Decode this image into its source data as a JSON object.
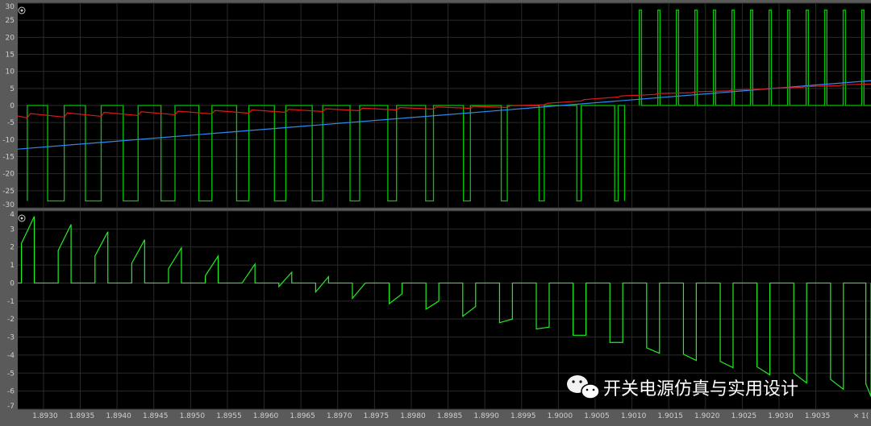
{
  "colors": {
    "background": "#000000",
    "frame": "#5a5a5a",
    "grid": "#2a2a2a",
    "tick_text": "#cfcfcf",
    "gate_green": "#00c800",
    "bright_green": "#22ee22",
    "red": "#e01818",
    "blue": "#2d8cf0"
  },
  "watermark": {
    "icon": "wechat-icon",
    "text": "开关电源仿真与实用设计"
  },
  "x_axis": {
    "range": [
      1.89265,
      1.90425
    ],
    "ticks": [
      "1.8930",
      "1.8935",
      "1.8940",
      "1.8945",
      "1.8950",
      "1.8955",
      "1.8960",
      "1.8965",
      "1.8970",
      "1.8975",
      "1.8980",
      "1.8985",
      "1.8990",
      "1.8995",
      "1.9000",
      "1.9005",
      "1.9010",
      "1.9015",
      "1.9020",
      "1.9025",
      "1.9030",
      "1.9035"
    ],
    "truncated_label": "1("
  },
  "chart_data": [
    {
      "type": "line",
      "title": "",
      "xlabel": "",
      "ylabel": "",
      "xlim": [
        1.89265,
        1.90425
      ],
      "ylim": [
        -30,
        30
      ],
      "y_ticks": [
        30,
        25,
        20,
        15,
        10,
        5,
        0,
        -5,
        -10,
        -15,
        -20,
        -25,
        -30
      ],
      "grid": true,
      "legend": "none",
      "series": [
        {
          "kind": "square_wave",
          "color": "#00c800",
          "segments": [
            {
              "x_start": 1.89265,
              "x_end": 1.9009,
              "period": 0.000502,
              "first_rise": 1.89278,
              "high": 0,
              "low": -28,
              "high_duty_start": 0.55,
              "high_duty_end": 0.93
            },
            {
              "x_start": 1.9011,
              "x_end": 1.90425,
              "period": 0.000252,
              "first_rise": 1.9011,
              "high": 28,
              "low": 0,
              "high_duty": 0.12
            }
          ]
        },
        {
          "kind": "line",
          "color": "#2d8cf0",
          "x": [
            1.89265,
            1.90425
          ],
          "y": [
            -12.8,
            7.3
          ]
        },
        {
          "kind": "sawtooth",
          "color": "#e01818",
          "period": 0.000502,
          "phase": 1.89278,
          "x": [
            1.89265,
            1.8995,
            1.901,
            1.90425
          ],
          "y_top": [
            -2.4,
            0.0,
            3.2,
            6.5
          ],
          "droop": [
            1.3,
            0.5,
            0.3,
            0.2
          ]
        }
      ]
    },
    {
      "type": "line",
      "title": "",
      "xlabel": "",
      "ylabel": "",
      "xlim": [
        1.89265,
        1.90425
      ],
      "ylim": [
        -7,
        4
      ],
      "y_ticks": [
        4,
        3,
        2,
        1,
        0,
        -1,
        -2,
        -3,
        -4,
        -5,
        -6,
        -7
      ],
      "grid": true,
      "legend": "none",
      "series": [
        {
          "kind": "pulse_ramp",
          "color": "#22ee22",
          "period": 0.000502,
          "first_start": 1.89265,
          "x_end": 1.90425,
          "pulses": [
            {
              "start": 1.8927,
              "jump": 2.2,
              "peak": 3.7,
              "width": 0.000175
            },
            {
              "start": 1.8932,
              "jump": 1.8,
              "peak": 3.25,
              "width": 0.000175
            },
            {
              "start": 1.8937,
              "jump": 1.5,
              "peak": 2.85,
              "width": 0.000175
            },
            {
              "start": 1.8942,
              "jump": 1.1,
              "peak": 2.4,
              "width": 0.000175
            },
            {
              "start": 1.8947,
              "jump": 0.8,
              "peak": 1.95,
              "width": 0.000175
            },
            {
              "start": 1.8952,
              "jump": 0.4,
              "peak": 1.5,
              "width": 0.000175
            },
            {
              "start": 1.8957,
              "jump": 0.0,
              "peak": 1.05,
              "width": 0.000175
            },
            {
              "start": 1.8962,
              "jump": -0.2,
              "peak": 0.6,
              "width": 0.000175
            },
            {
              "start": 1.8967,
              "jump": -0.5,
              "peak": 0.35,
              "width": 0.000175
            },
            {
              "start": 1.8972,
              "jump": -0.85,
              "peak": 0.0,
              "width": 0.000175
            },
            {
              "start": 1.8977,
              "jump": -1.15,
              "peak": -0.6,
              "width": 0.000175
            },
            {
              "start": 1.8982,
              "jump": -1.45,
              "peak": -1.0,
              "width": 0.000175
            },
            {
              "start": 1.8987,
              "jump": -1.85,
              "peak": -1.3,
              "width": 0.000175
            },
            {
              "start": 1.8992,
              "jump": -2.2,
              "peak": -2.0,
              "width": 0.000175
            },
            {
              "start": 1.8997,
              "jump": -2.55,
              "peak": -2.45,
              "width": 0.000175
            },
            {
              "start": 1.9002,
              "jump": -2.9,
              "peak": -2.9,
              "width": 0.000175
            },
            {
              "start": 1.9007,
              "jump": -3.3,
              "peak": -3.3,
              "width": 0.000175
            },
            {
              "start": 1.9012,
              "jump": -3.6,
              "peak": -3.9,
              "width": 0.000175
            },
            {
              "start": 1.9017,
              "jump": -3.95,
              "peak": -4.3,
              "width": 0.000175
            },
            {
              "start": 1.9022,
              "jump": -4.35,
              "peak": -4.7,
              "width": 0.000175
            },
            {
              "start": 1.9027,
              "jump": -4.65,
              "peak": -5.1,
              "width": 0.000175
            },
            {
              "start": 1.9032,
              "jump": -5.0,
              "peak": -5.55,
              "width": 0.000175
            },
            {
              "start": 1.9037,
              "jump": -5.35,
              "peak": -5.9,
              "width": 0.000175
            },
            {
              "start": 1.90418,
              "jump": -5.6,
              "peak": -6.3,
              "width": 0.000175
            }
          ]
        }
      ]
    }
  ]
}
